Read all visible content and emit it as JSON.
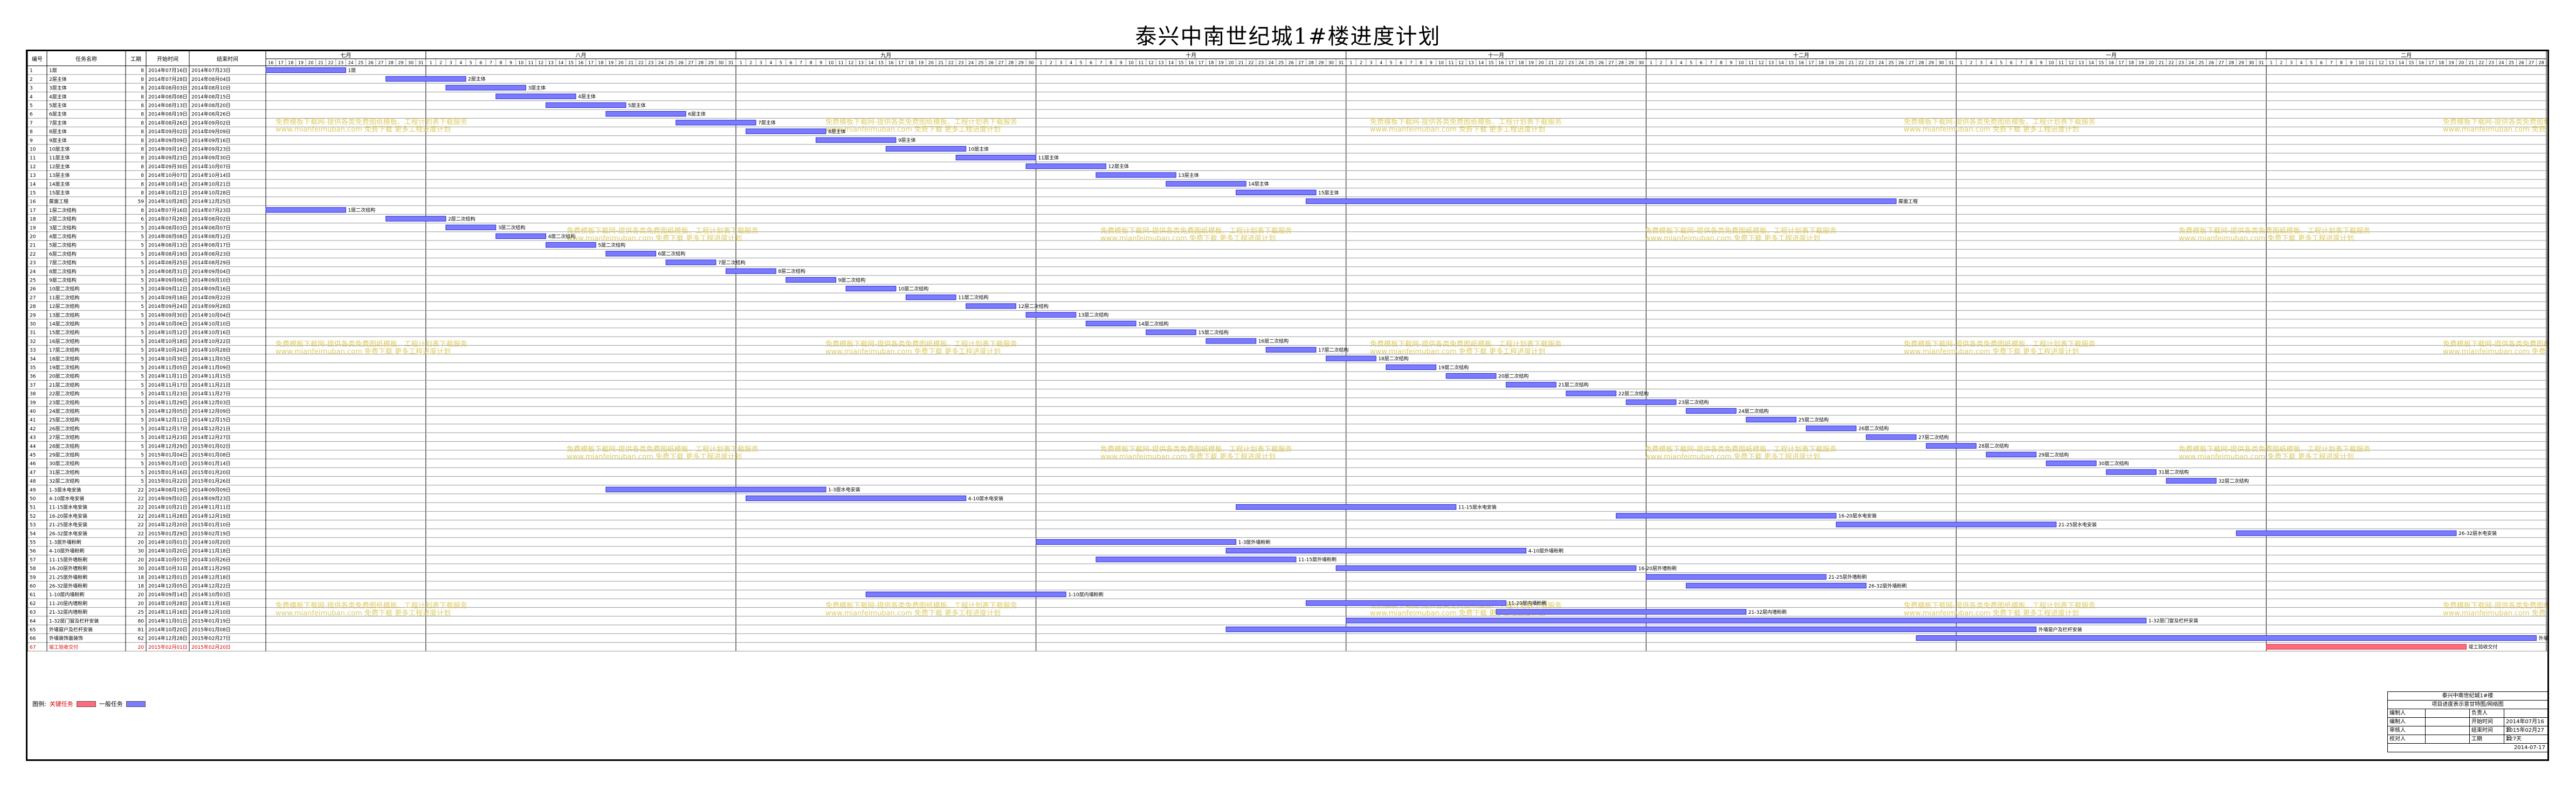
{
  "title": "泰兴中南世纪城1#楼进度计划",
  "legend": {
    "label": "图例:",
    "critical": "关键任务",
    "normal": "一般任务"
  },
  "colors": {
    "bar": "#7b7bff",
    "critical": "#ff6b7a",
    "watermark": "#d7c247"
  },
  "watermark_lines": [
    "免费模板下载网-提供各类免费图纸模板、工程计划表下载服务",
    "www.mianfeimuban.com 免费下载 更多工程进度计划"
  ],
  "chart_data": {
    "type": "gantt",
    "columns": [
      "编号",
      "任务名称",
      "工期",
      "开始时间",
      "结束时间"
    ],
    "months": [
      {
        "label": "七月",
        "start": "2014-07-16",
        "days": 16
      },
      {
        "label": "八月",
        "start": "2014-08-01",
        "days": 31
      },
      {
        "label": "九月",
        "start": "2014-09-01",
        "days": 30
      },
      {
        "label": "十月",
        "start": "2014-10-01",
        "days": 31
      },
      {
        "label": "十一月",
        "start": "2014-11-01",
        "days": 30
      },
      {
        "label": "十二月",
        "start": "2014-12-01",
        "days": 31
      },
      {
        "label": "一月",
        "start": "2015-01-01",
        "days": 31
      },
      {
        "label": "二月",
        "start": "2015-02-01",
        "days": 28
      }
    ],
    "tasks": [
      {
        "id": "1",
        "name": "1层",
        "duration": 8,
        "start": "2014-07-16",
        "end": "2014-07-23"
      },
      {
        "id": "2",
        "name": "2层主体",
        "duration": 8,
        "start": "2014-07-28",
        "end": "2014-08-04"
      },
      {
        "id": "3",
        "name": "3层主体",
        "duration": 8,
        "start": "2014-08-03",
        "end": "2014-08-10"
      },
      {
        "id": "4",
        "name": "4层主体",
        "duration": 8,
        "start": "2014-08-08",
        "end": "2014-08-15"
      },
      {
        "id": "5",
        "name": "5层主体",
        "duration": 8,
        "start": "2014-08-13",
        "end": "2014-08-20"
      },
      {
        "id": "6",
        "name": "6层主体",
        "duration": 8,
        "start": "2014-08-19",
        "end": "2014-08-26"
      },
      {
        "id": "7",
        "name": "7层主体",
        "duration": 8,
        "start": "2014-08-26",
        "end": "2014-09-02"
      },
      {
        "id": "8",
        "name": "8层主体",
        "duration": 8,
        "start": "2014-09-02",
        "end": "2014-09-09"
      },
      {
        "id": "9",
        "name": "9层主体",
        "duration": 8,
        "start": "2014-09-09",
        "end": "2014-09-16"
      },
      {
        "id": "10",
        "name": "10层主体",
        "duration": 8,
        "start": "2014-09-16",
        "end": "2014-09-23"
      },
      {
        "id": "11",
        "name": "11层主体",
        "duration": 8,
        "start": "2014-09-23",
        "end": "2014-09-30"
      },
      {
        "id": "12",
        "name": "12层主体",
        "duration": 8,
        "start": "2014-09-30",
        "end": "2014-10-07"
      },
      {
        "id": "13",
        "name": "13层主体",
        "duration": 8,
        "start": "2014-10-07",
        "end": "2014-10-14"
      },
      {
        "id": "14",
        "name": "14层主体",
        "duration": 8,
        "start": "2014-10-14",
        "end": "2014-10-21"
      },
      {
        "id": "15",
        "name": "15层主体",
        "duration": 8,
        "start": "2014-10-21",
        "end": "2014-10-28"
      },
      {
        "id": "16",
        "name": "屋面工程",
        "duration": 59,
        "start": "2014-10-28",
        "end": "2014-12-25"
      },
      {
        "id": "17",
        "name": "1层二次结构",
        "duration": 8,
        "start": "2014-07-16",
        "end": "2014-07-23"
      },
      {
        "id": "18",
        "name": "2层二次结构",
        "duration": 6,
        "start": "2014-07-28",
        "end": "2014-08-02"
      },
      {
        "id": "19",
        "name": "3层二次结构",
        "duration": 5,
        "start": "2014-08-03",
        "end": "2014-08-07"
      },
      {
        "id": "20",
        "name": "4层二次结构",
        "duration": 5,
        "start": "2014-08-08",
        "end": "2014-08-12"
      },
      {
        "id": "21",
        "name": "5层二次结构",
        "duration": 5,
        "start": "2014-08-13",
        "end": "2014-08-17"
      },
      {
        "id": "22",
        "name": "6层二次结构",
        "duration": 5,
        "start": "2014-08-19",
        "end": "2014-08-23"
      },
      {
        "id": "23",
        "name": "7层二次结构",
        "duration": 5,
        "start": "2014-08-25",
        "end": "2014-08-29"
      },
      {
        "id": "24",
        "name": "8层二次结构",
        "duration": 5,
        "start": "2014-08-31",
        "end": "2014-09-04"
      },
      {
        "id": "25",
        "name": "9层二次结构",
        "duration": 5,
        "start": "2014-09-06",
        "end": "2014-09-10"
      },
      {
        "id": "26",
        "name": "10层二次结构",
        "duration": 5,
        "start": "2014-09-12",
        "end": "2014-09-16"
      },
      {
        "id": "27",
        "name": "11层二次结构",
        "duration": 5,
        "start": "2014-09-18",
        "end": "2014-09-22"
      },
      {
        "id": "28",
        "name": "12层二次结构",
        "duration": 5,
        "start": "2014-09-24",
        "end": "2014-09-28"
      },
      {
        "id": "29",
        "name": "13层二次结构",
        "duration": 5,
        "start": "2014-09-30",
        "end": "2014-10-04"
      },
      {
        "id": "30",
        "name": "14层二次结构",
        "duration": 5,
        "start": "2014-10-06",
        "end": "2014-10-10"
      },
      {
        "id": "31",
        "name": "15层二次结构",
        "duration": 5,
        "start": "2014-10-12",
        "end": "2014-10-16"
      },
      {
        "id": "32",
        "name": "16层二次结构",
        "duration": 5,
        "start": "2014-10-18",
        "end": "2014-10-22"
      },
      {
        "id": "33",
        "name": "17层二次结构",
        "duration": 5,
        "start": "2014-10-24",
        "end": "2014-10-28"
      },
      {
        "id": "34",
        "name": "18层二次结构",
        "duration": 5,
        "start": "2014-10-30",
        "end": "2014-11-03"
      },
      {
        "id": "35",
        "name": "19层二次结构",
        "duration": 5,
        "start": "2014-11-05",
        "end": "2014-11-09"
      },
      {
        "id": "36",
        "name": "20层二次结构",
        "duration": 5,
        "start": "2014-11-11",
        "end": "2014-11-15"
      },
      {
        "id": "37",
        "name": "21层二次结构",
        "duration": 5,
        "start": "2014-11-17",
        "end": "2014-11-21"
      },
      {
        "id": "38",
        "name": "22层二次结构",
        "duration": 5,
        "start": "2014-11-23",
        "end": "2014-11-27"
      },
      {
        "id": "39",
        "name": "23层二次结构",
        "duration": 5,
        "start": "2014-11-29",
        "end": "2014-12-03"
      },
      {
        "id": "40",
        "name": "24层二次结构",
        "duration": 5,
        "start": "2014-12-05",
        "end": "2014-12-09"
      },
      {
        "id": "41",
        "name": "25层二次结构",
        "duration": 5,
        "start": "2014-12-11",
        "end": "2014-12-15"
      },
      {
        "id": "42",
        "name": "26层二次结构",
        "duration": 5,
        "start": "2014-12-17",
        "end": "2014-12-21"
      },
      {
        "id": "43",
        "name": "27层二次结构",
        "duration": 5,
        "start": "2014-12-23",
        "end": "2014-12-27"
      },
      {
        "id": "44",
        "name": "28层二次结构",
        "duration": 5,
        "start": "2014-12-29",
        "end": "2015-01-02"
      },
      {
        "id": "45",
        "name": "29层二次结构",
        "duration": 5,
        "start": "2015-01-04",
        "end": "2015-01-08"
      },
      {
        "id": "46",
        "name": "30层二次结构",
        "duration": 5,
        "start": "2015-01-10",
        "end": "2015-01-14"
      },
      {
        "id": "47",
        "name": "31层二次结构",
        "duration": 5,
        "start": "2015-01-16",
        "end": "2015-01-20"
      },
      {
        "id": "48",
        "name": "32层二次结构",
        "duration": 5,
        "start": "2015-01-22",
        "end": "2015-01-26"
      },
      {
        "id": "49",
        "name": "1-3层水电安装",
        "duration": 22,
        "start": "2014-08-19",
        "end": "2014-09-09"
      },
      {
        "id": "50",
        "name": "4-10层水电安装",
        "duration": 22,
        "start": "2014-09-02",
        "end": "2014-09-23"
      },
      {
        "id": "51",
        "name": "11-15层水电安装",
        "duration": 22,
        "start": "2014-10-21",
        "end": "2014-11-11"
      },
      {
        "id": "52",
        "name": "16-20层水电安装",
        "duration": 22,
        "start": "2014-11-28",
        "end": "2014-12-19"
      },
      {
        "id": "53",
        "name": "21-25层水电安装",
        "duration": 22,
        "start": "2014-12-20",
        "end": "2015-01-10"
      },
      {
        "id": "54",
        "name": "26-32层水电安装",
        "duration": 22,
        "start": "2015-01-29",
        "end": "2015-02-19"
      },
      {
        "id": "55",
        "name": "1-3层外墙粉刷",
        "duration": 20,
        "start": "2014-10-01",
        "end": "2014-10-20"
      },
      {
        "id": "56",
        "name": "4-10层外墙粉刷",
        "duration": 30,
        "start": "2014-10-20",
        "end": "2014-11-18"
      },
      {
        "id": "57",
        "name": "11-15层外墙粉刷",
        "duration": 20,
        "start": "2014-10-07",
        "end": "2014-10-26"
      },
      {
        "id": "58",
        "name": "16-20层外墙粉刷",
        "duration": 30,
        "start": "2014-10-31",
        "end": "2014-11-29"
      },
      {
        "id": "59",
        "name": "21-25层外墙粉刷",
        "duration": 18,
        "start": "2014-12-01",
        "end": "2014-12-18"
      },
      {
        "id": "60",
        "name": "26-32层外墙粉刷",
        "duration": 18,
        "start": "2014-12-05",
        "end": "2014-12-22"
      },
      {
        "id": "61",
        "name": "1-10层内墙粉刷",
        "duration": 20,
        "start": "2014-09-14",
        "end": "2014-10-03"
      },
      {
        "id": "62",
        "name": "11-20层内墙粉刷",
        "duration": 20,
        "start": "2014-10-28",
        "end": "2014-11-16"
      },
      {
        "id": "63",
        "name": "21-32层内墙粉刷",
        "duration": 25,
        "start": "2014-11-16",
        "end": "2014-12-10"
      },
      {
        "id": "64",
        "name": "1-32层门窗及栏杆安装",
        "duration": 80,
        "start": "2014-11-01",
        "end": "2015-01-19"
      },
      {
        "id": "65",
        "name": "外墙窗户及栏杆安装",
        "duration": 81,
        "start": "2014-10-20",
        "end": "2015-01-08"
      },
      {
        "id": "66",
        "name": "外墙装饰面装饰",
        "duration": 62,
        "start": "2014-12-28",
        "end": "2015-02-27"
      },
      {
        "id": "67",
        "name": "竣工验收交付",
        "duration": 20,
        "start": "2015-02-01",
        "end": "2015-02-20",
        "critical": true
      }
    ]
  },
  "titleblock": {
    "project": "泰兴中南世纪城1#楼",
    "subtitle": "项目进度表示意甘特图/网络图",
    "rows": [
      {
        "k": "编制人",
        "v": "",
        "k2": "负责人",
        "v2": ""
      },
      {
        "k": "编制人",
        "v": "",
        "k2": "开始时间",
        "v2": "2014年07月16日"
      },
      {
        "k": "审核人",
        "v": "",
        "k2": "结束时间",
        "v2": "2015年02月27日"
      },
      {
        "k": "校对人",
        "v": "",
        "k2": "工期",
        "v2": "227天"
      }
    ],
    "date": "2014-07-17"
  }
}
